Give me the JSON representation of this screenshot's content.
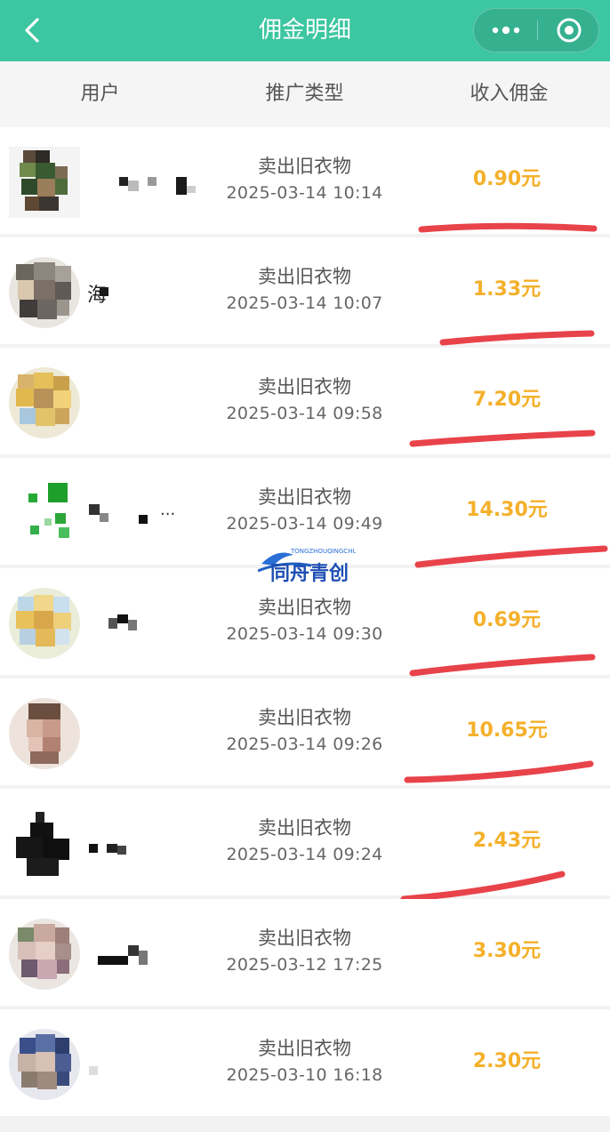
{
  "nav": {
    "title": "佣金明细",
    "back_icon": "chevron-left-icon",
    "more_icon": "more-dots-icon",
    "close_icon": "target-circle-icon",
    "bg_color": "#3cc6a1"
  },
  "table_header": {
    "user": "用户",
    "type": "推广类型",
    "income": "收入佣金"
  },
  "records": [
    {
      "nick": "",
      "type": "卖出旧衣物",
      "time": "2025-03-14 10:14",
      "amount": "0.90元",
      "highlighted": true
    },
    {
      "nick": "海",
      "type": "卖出旧衣物",
      "time": "2025-03-14 10:07",
      "amount": "1.33元",
      "highlighted": true
    },
    {
      "nick": "",
      "type": "卖出旧衣物",
      "time": "2025-03-14 09:58",
      "amount": "7.20元",
      "highlighted": true
    },
    {
      "nick": "...",
      "type": "卖出旧衣物",
      "time": "2025-03-14 09:49",
      "amount": "14.30元",
      "highlighted": true
    },
    {
      "nick": "",
      "type": "卖出旧衣物",
      "time": "2025-03-14 09:30",
      "amount": "0.69元",
      "highlighted": true
    },
    {
      "nick": "",
      "type": "卖出旧衣物",
      "time": "2025-03-14 09:26",
      "amount": "10.65元",
      "highlighted": true
    },
    {
      "nick": "",
      "type": "卖出旧衣物",
      "time": "2025-03-14 09:24",
      "amount": "2.43元",
      "highlighted": true
    },
    {
      "nick": "",
      "type": "卖出旧衣物",
      "time": "2025-03-12 17:25",
      "amount": "3.30元",
      "highlighted": false
    },
    {
      "nick": "",
      "type": "卖出旧衣物",
      "time": "2025-03-10 16:18",
      "amount": "2.30元",
      "highlighted": false
    }
  ],
  "watermark": {
    "text": "同舟青创",
    "subtext": "TONGZHOUQINGCHUANG"
  },
  "colors": {
    "amount": "#f4b02a",
    "marker": "#e8434a",
    "header_bg": "#f5f5f5"
  }
}
